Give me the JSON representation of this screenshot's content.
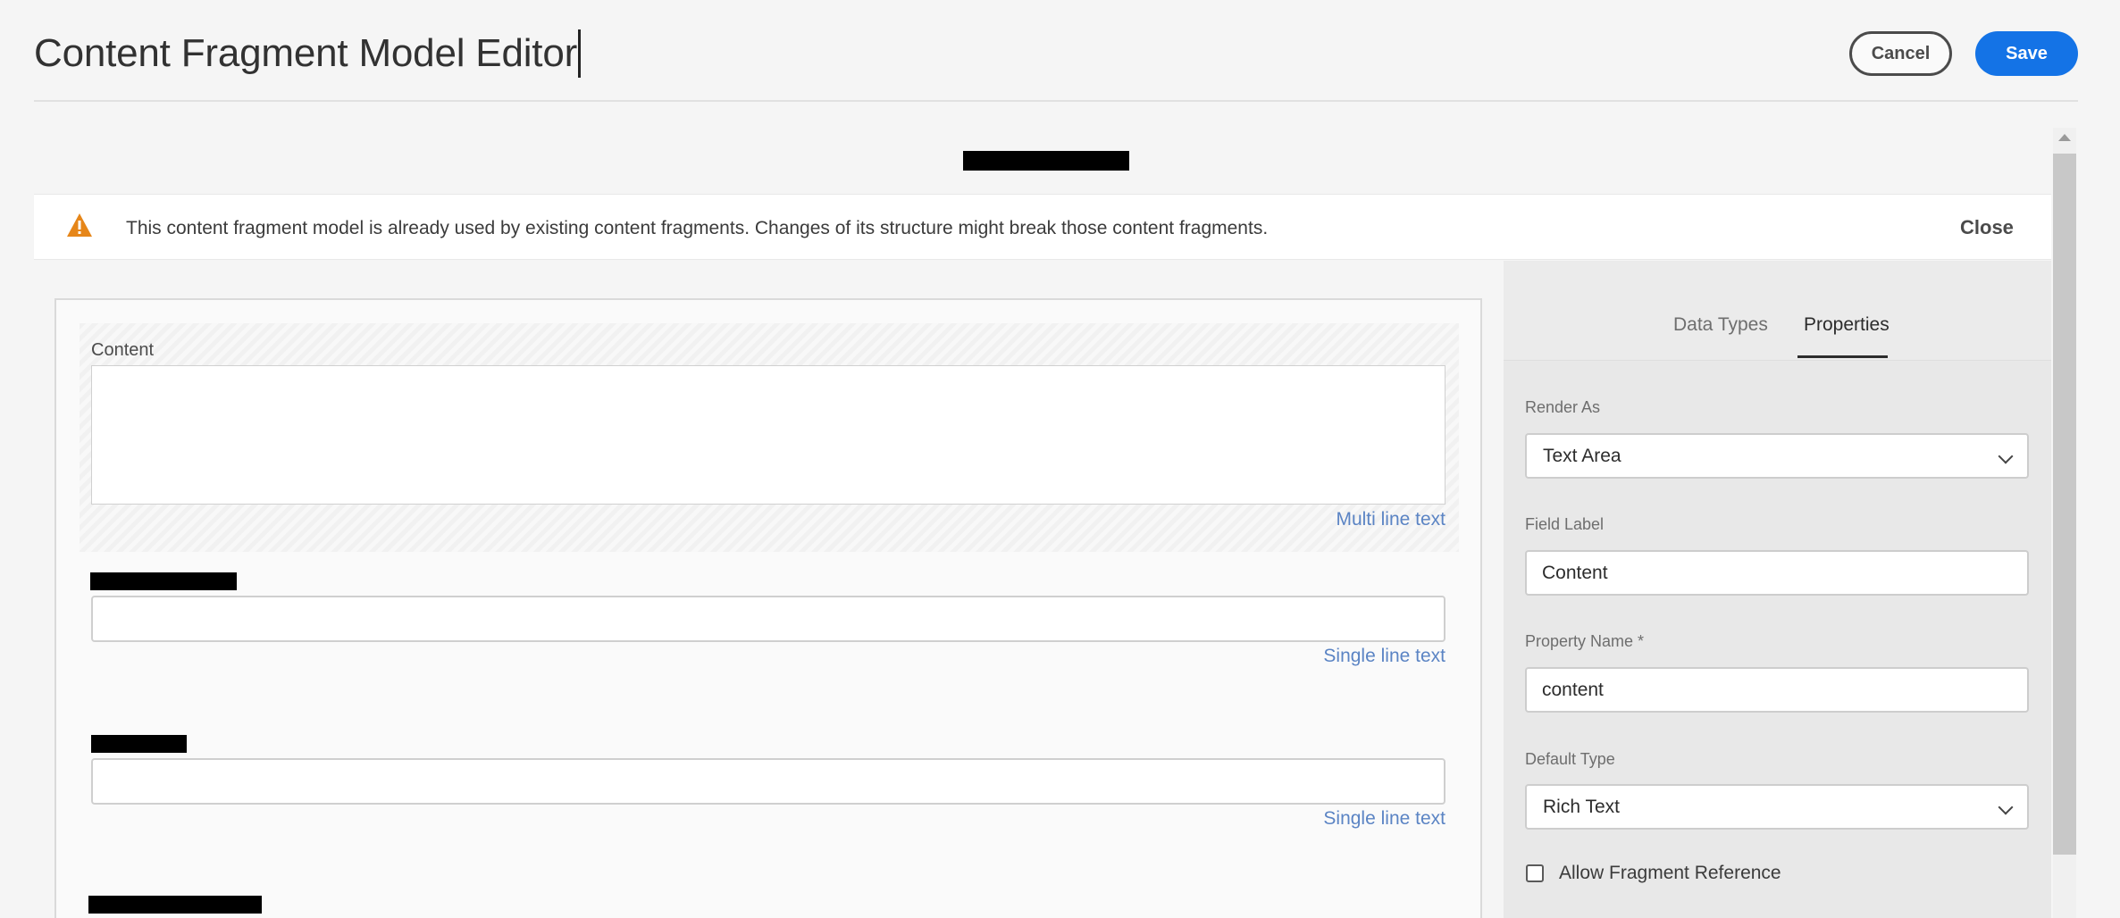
{
  "header": {
    "title": "Content Fragment Model Editor",
    "cancel_label": "Cancel",
    "save_label": "Save"
  },
  "alert": {
    "icon": "alert-triangle-icon",
    "message": "This content fragment model is already used by existing content fragments. Changes of its structure might break those content fragments.",
    "close_label": "Close",
    "icon_color": "#e68619"
  },
  "canvas": {
    "fields": [
      {
        "label": "Content",
        "type_hint": "Multi line text",
        "selected": true
      },
      {
        "label": "",
        "type_hint": "Single line text"
      },
      {
        "label": "",
        "type_hint": "Single line text"
      }
    ]
  },
  "panel": {
    "tabs": [
      {
        "label": "Data Types",
        "active": false
      },
      {
        "label": "Properties",
        "active": true
      }
    ],
    "render_as": {
      "label": "Render As",
      "value": "Text Area"
    },
    "field_label": {
      "label": "Field Label",
      "value": "Content"
    },
    "property_name": {
      "label": "Property Name *",
      "value": "content"
    },
    "default_type": {
      "label": "Default Type",
      "value": "Rich Text"
    },
    "allow_fragment_reference": {
      "label": "Allow Fragment Reference",
      "checked": false
    }
  },
  "colors": {
    "accent": "#1473e6",
    "type_hint": "#5b84c4"
  }
}
